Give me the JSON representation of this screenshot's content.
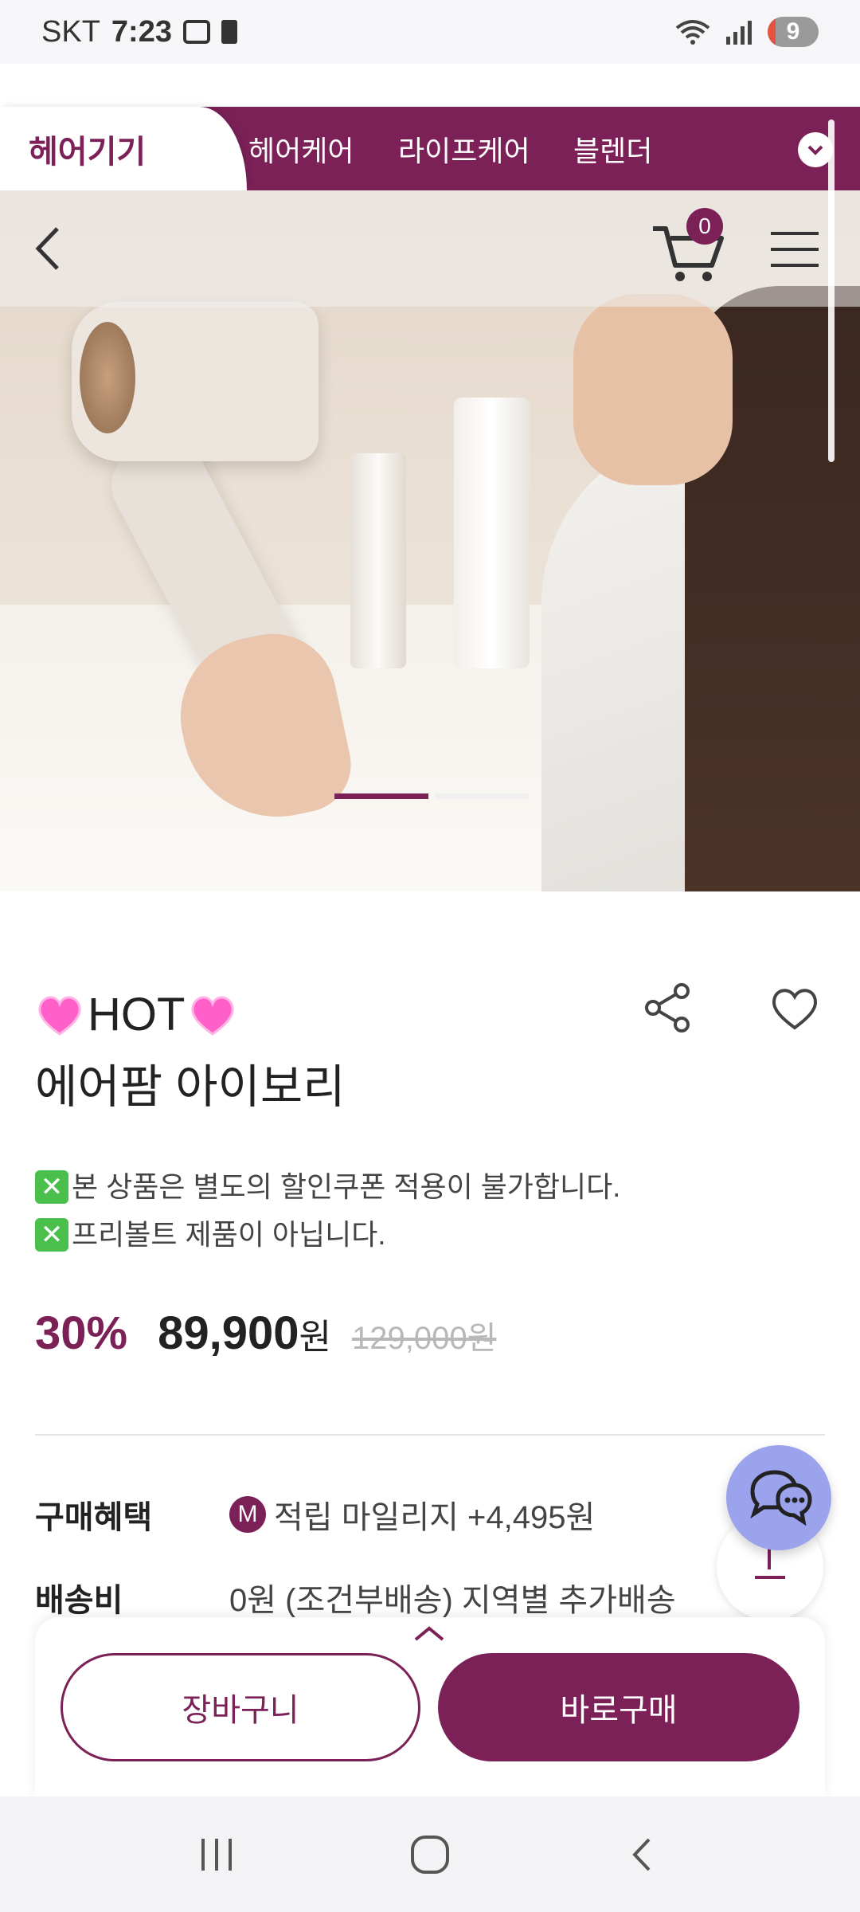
{
  "status_bar": {
    "carrier": "SKT",
    "time": "7:23",
    "battery_level": "9"
  },
  "category_tabs": {
    "active": "헤어기기",
    "items": [
      "헤어케어",
      "라이프케어",
      "블렌더"
    ]
  },
  "header": {
    "cart_count": "0"
  },
  "carousel": {
    "current_slide": 1,
    "total_slides": 2
  },
  "product": {
    "hot_text": "HOT",
    "name": "에어팜 아이보리",
    "notes": [
      "본 상품은 별도의 할인쿠폰 적용이 불가합니다.",
      "프리볼트 제품이 아닙니다."
    ],
    "discount": "30%",
    "price": "89,900",
    "currency": "원",
    "original_price": "129,000원"
  },
  "benefits": {
    "label": "구매혜택",
    "badge": "M",
    "value": "적립 마일리지 +4,495원"
  },
  "shipping": {
    "label": "배송비",
    "value": "0원 (조건부배송) 지역별 추가배송"
  },
  "actions": {
    "cart_label": "장바구니",
    "buy_label": "바로구매"
  },
  "colors": {
    "brand": "#7b2158",
    "chat": "#9aa3ec"
  }
}
